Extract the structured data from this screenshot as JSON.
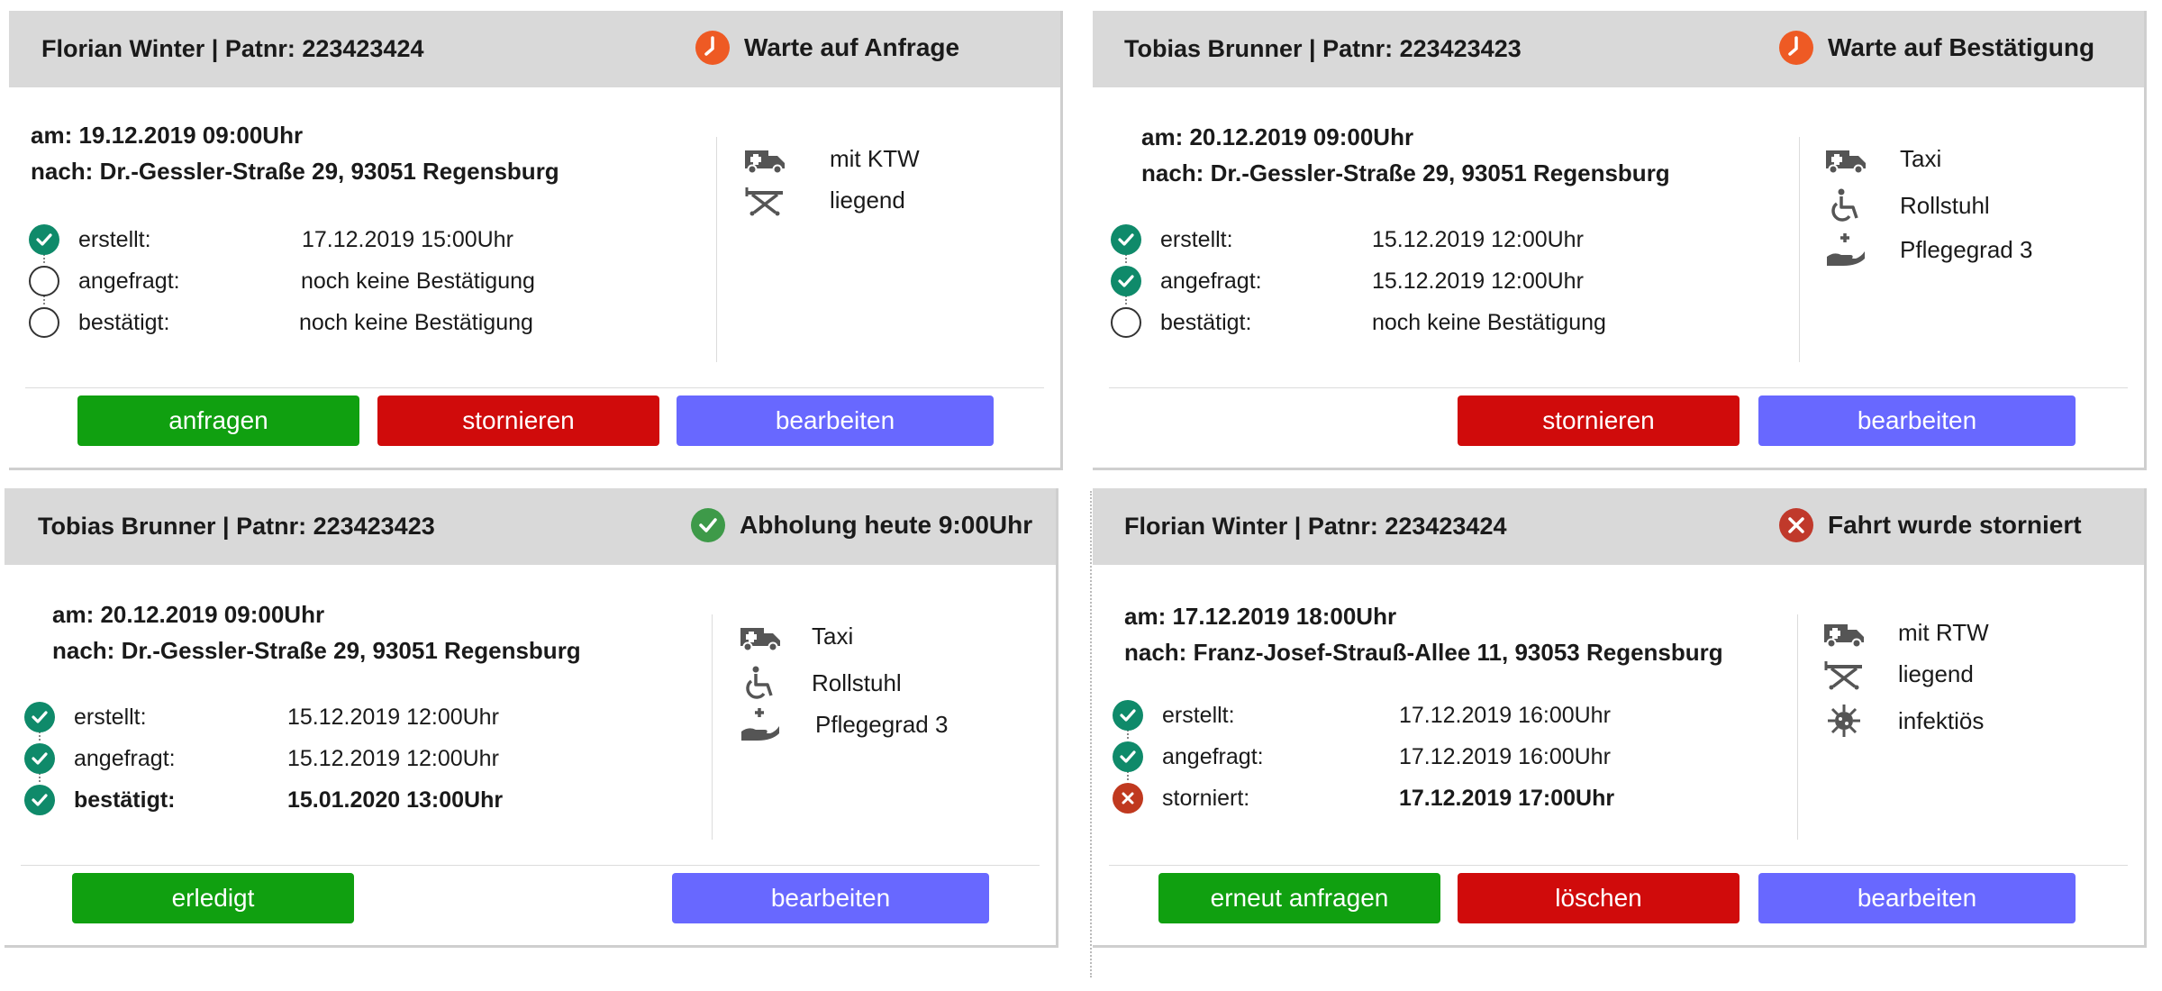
{
  "cards": [
    {
      "title": "Florian Winter | Patnr: 223423424",
      "status": {
        "text": "Warte auf Anfrage",
        "icon": "clock-icon",
        "color": "#ee5a24"
      },
      "date": "am: 19.12.2019 09:00Uhr",
      "destination": "nach: Dr.-Gessler-Straße 29, 93051 Regensburg",
      "steps": [
        {
          "label": "erstellt:",
          "value": "17.12.2019 15:00Uhr",
          "state": "done"
        },
        {
          "label": "angefragt:",
          "value": "noch keine Bestätigung",
          "state": "empty"
        },
        {
          "label": "bestätigt:",
          "value": "noch keine Bestätigung",
          "state": "empty"
        }
      ],
      "features": [
        {
          "icon": "ambulance-icon",
          "label": "mit KTW"
        },
        {
          "icon": "stretcher-icon",
          "label": "liegend"
        }
      ],
      "buttons": [
        {
          "label": "anfragen",
          "color": "#10a010"
        },
        {
          "label": "stornieren",
          "color": "#d00b0b"
        },
        {
          "label": "bearbeiten",
          "color": "#6868ff"
        }
      ]
    },
    {
      "title": "Tobias Brunner | Patnr: 223423423",
      "status": {
        "text": "Warte auf Bestätigung",
        "icon": "clock-icon",
        "color": "#ee5a24"
      },
      "date": "am: 20.12.2019 09:00Uhr",
      "destination": "nach: Dr.-Gessler-Straße 29, 93051 Regensburg",
      "steps": [
        {
          "label": "erstellt:",
          "value": "15.12.2019 12:00Uhr",
          "state": "done"
        },
        {
          "label": "angefragt:",
          "value": "15.12.2019 12:00Uhr",
          "state": "done"
        },
        {
          "label": "bestätigt:",
          "value": "noch keine Bestätigung",
          "state": "empty"
        }
      ],
      "features": [
        {
          "icon": "ambulance-icon",
          "label": "Taxi"
        },
        {
          "icon": "wheelchair-icon",
          "label": "Rollstuhl"
        },
        {
          "icon": "care-hand-icon",
          "label": "Pflegegrad 3"
        }
      ],
      "buttons": [
        {
          "label": "stornieren",
          "color": "#d00b0b"
        },
        {
          "label": "bearbeiten",
          "color": "#6868ff"
        }
      ]
    },
    {
      "title": "Tobias Brunner | Patnr: 223423423",
      "status": {
        "text": "Abholung heute 9:00Uhr",
        "icon": "check-icon",
        "color": "#3e9a49"
      },
      "date": "am: 20.12.2019 09:00Uhr",
      "destination": "nach: Dr.-Gessler-Straße 29, 93051 Regensburg",
      "steps": [
        {
          "label": "erstellt:",
          "value": "15.12.2019 12:00Uhr",
          "state": "done"
        },
        {
          "label": "angefragt:",
          "value": "15.12.2019 12:00Uhr",
          "state": "done"
        },
        {
          "label": "bestätigt:",
          "value": "15.01.2020 13:00Uhr",
          "state": "done",
          "bold": true
        }
      ],
      "features": [
        {
          "icon": "ambulance-icon",
          "label": "Taxi"
        },
        {
          "icon": "wheelchair-icon",
          "label": "Rollstuhl"
        },
        {
          "icon": "care-hand-icon",
          "label": "Pflegegrad 3"
        }
      ],
      "buttons": [
        {
          "label": "erledigt",
          "color": "#10a010"
        },
        {
          "label": "bearbeiten",
          "color": "#6868ff"
        }
      ]
    },
    {
      "title": "Florian Winter | Patnr: 223423424",
      "status": {
        "text": "Fahrt wurde storniert",
        "icon": "cancel-icon",
        "color": "#c0392b"
      },
      "date": "am: 17.12.2019 18:00Uhr",
      "destination": "nach: Franz-Josef-Strauß-Allee 11, 93053 Regensburg",
      "steps": [
        {
          "label": "erstellt:",
          "value": "17.12.2019 16:00Uhr",
          "state": "done"
        },
        {
          "label": "angefragt:",
          "value": "17.12.2019 16:00Uhr",
          "state": "done"
        },
        {
          "label": "storniert:",
          "value": "17.12.2019 17:00Uhr",
          "state": "cancel",
          "bold": true
        }
      ],
      "features": [
        {
          "icon": "ambulance-icon",
          "label": "mit RTW"
        },
        {
          "icon": "stretcher-icon",
          "label": "liegend"
        },
        {
          "icon": "virus-icon",
          "label": "infektiös"
        }
      ],
      "buttons": [
        {
          "label": "erneut anfragen",
          "color": "#10a010"
        },
        {
          "label": "löschen",
          "color": "#d00b0b"
        },
        {
          "label": "bearbeiten",
          "color": "#6868ff"
        }
      ]
    }
  ]
}
